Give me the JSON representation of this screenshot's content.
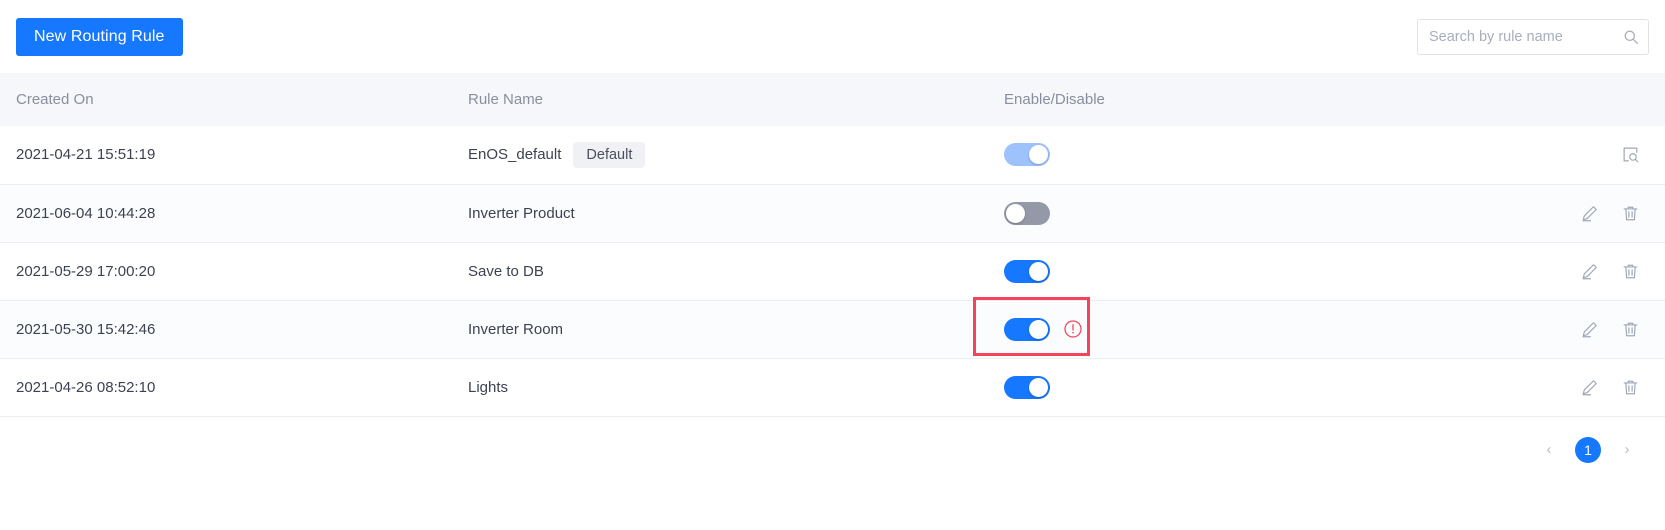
{
  "toolbar": {
    "new_rule_label": "New Routing Rule",
    "search": {
      "placeholder": "Search by rule name",
      "value": "",
      "icon": "search-icon"
    }
  },
  "colors": {
    "primary": "#1677ff",
    "toggle_on": "#1677ff",
    "toggle_on_disabled": "#9ec2fb",
    "toggle_off": "#9499a8",
    "highlight_box": "#f5435a",
    "warning": "#f5475d",
    "header_bg": "#f6f7fb",
    "text": "#3d4250",
    "muted_text": "#8a8f9e"
  },
  "table": {
    "columns": [
      "Created On",
      "Rule Name",
      "Enable/Disable",
      ""
    ],
    "rows": [
      {
        "created_on": "2021-04-21 15:51:19",
        "rule_name": "EnOS_default",
        "badge": "Default",
        "enabled": true,
        "toggle_state": "on-disabled",
        "highlighted": false,
        "warning": false,
        "actions": [
          "view-log-icon"
        ]
      },
      {
        "created_on": "2021-06-04 10:44:28",
        "rule_name": "Inverter Product",
        "badge": "",
        "enabled": false,
        "toggle_state": "off",
        "highlighted": false,
        "warning": false,
        "actions": [
          "edit-icon",
          "delete-icon"
        ]
      },
      {
        "created_on": "2021-05-29 17:00:20",
        "rule_name": "Save to DB",
        "badge": "",
        "enabled": true,
        "toggle_state": "on",
        "highlighted": false,
        "warning": false,
        "actions": [
          "edit-icon",
          "delete-icon"
        ]
      },
      {
        "created_on": "2021-05-30 15:42:46",
        "rule_name": "Inverter Room",
        "badge": "",
        "enabled": true,
        "toggle_state": "on",
        "highlighted": true,
        "warning": true,
        "actions": [
          "edit-icon",
          "delete-icon"
        ]
      },
      {
        "created_on": "2021-04-26 08:52:10",
        "rule_name": "Lights",
        "badge": "",
        "enabled": true,
        "toggle_state": "on",
        "highlighted": false,
        "warning": false,
        "actions": [
          "edit-icon",
          "delete-icon"
        ]
      }
    ]
  },
  "pagination": {
    "prev": "‹",
    "next": "›",
    "current_page": "1"
  }
}
